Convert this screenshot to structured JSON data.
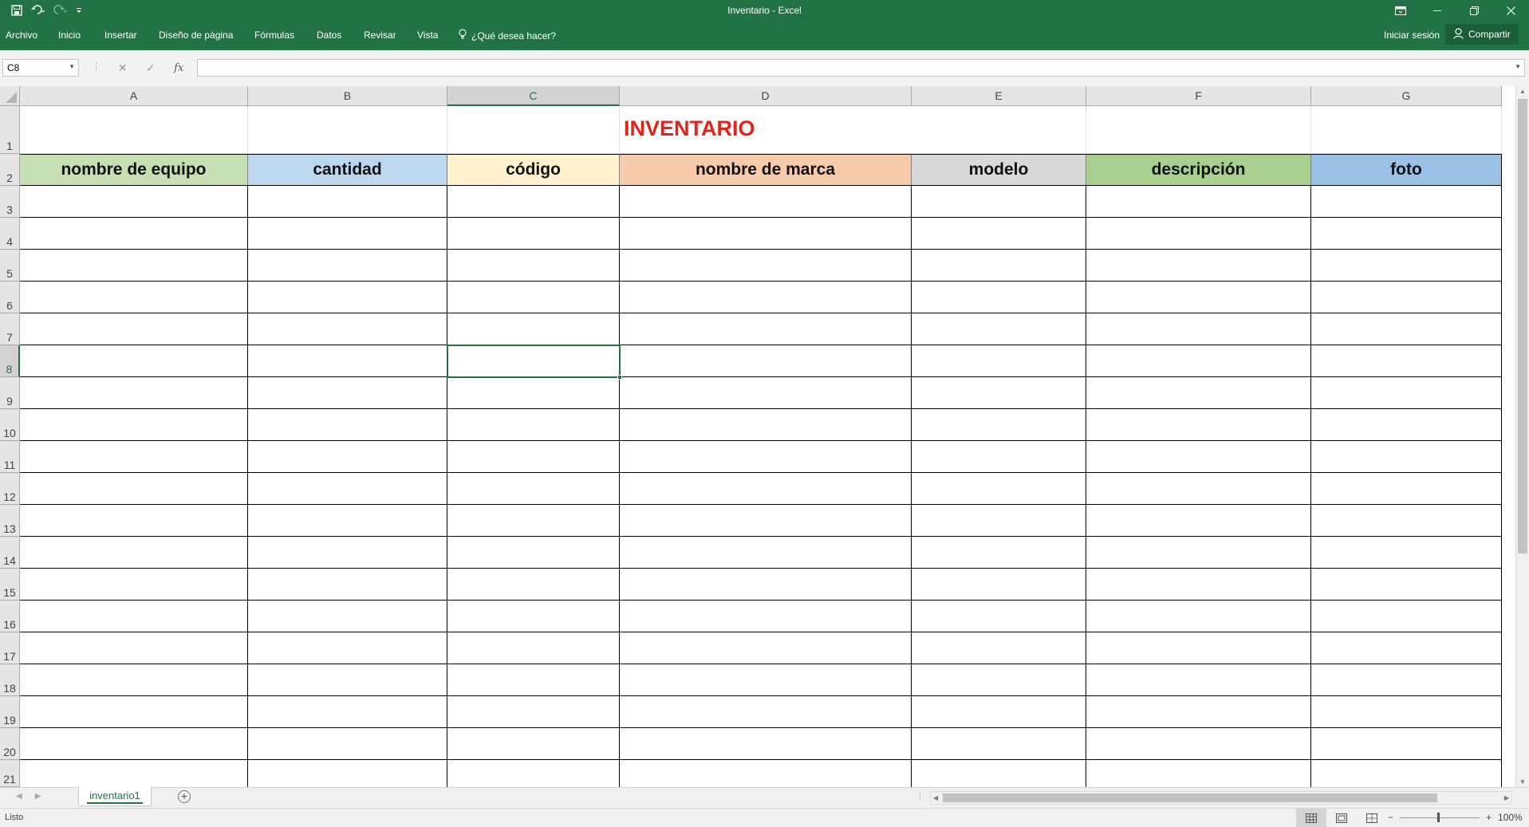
{
  "app": {
    "window_title": "Inventario - Excel"
  },
  "menu": {
    "items": [
      "Archivo",
      "Inicio",
      "Insertar",
      "Diseño de página",
      "Fórmulas",
      "Datos",
      "Revisar",
      "Vista"
    ],
    "tell_me": "¿Qué desea hacer?",
    "sign_in": "Iniciar sesión",
    "share": "Compartir"
  },
  "formula_bar": {
    "name_box": "C8",
    "fx_label": "fx",
    "formula_value": ""
  },
  "sheet": {
    "columns": [
      "A",
      "B",
      "C",
      "D",
      "E",
      "F",
      "G"
    ],
    "selected_column": "C",
    "rows": [
      "1",
      "2",
      "3",
      "4",
      "5",
      "6",
      "7",
      "8",
      "9",
      "10",
      "11",
      "12",
      "13",
      "14",
      "15",
      "16",
      "17",
      "18",
      "19",
      "20",
      "21"
    ],
    "selected_row": "8",
    "title": "INVENTARIO",
    "title_color": "#e2231a",
    "headers": [
      {
        "label": "nombre de equipo",
        "color": "#c6e0b4"
      },
      {
        "label": "cantidad",
        "color": "#bdd7ee"
      },
      {
        "label": "código",
        "color": "#fff2cc"
      },
      {
        "label": "nombre de marca",
        "color": "#f8cbad"
      },
      {
        "label": "modelo",
        "color": "#d9d9d9"
      },
      {
        "label": "descripción",
        "color": "#a9d08e"
      },
      {
        "label": "foto",
        "color": "#9bc2e6"
      }
    ]
  },
  "tabs": {
    "sheets": [
      "inventario1"
    ]
  },
  "status": {
    "text": "Listo",
    "zoom": "100%"
  },
  "colors": {
    "accent": "#217346"
  }
}
